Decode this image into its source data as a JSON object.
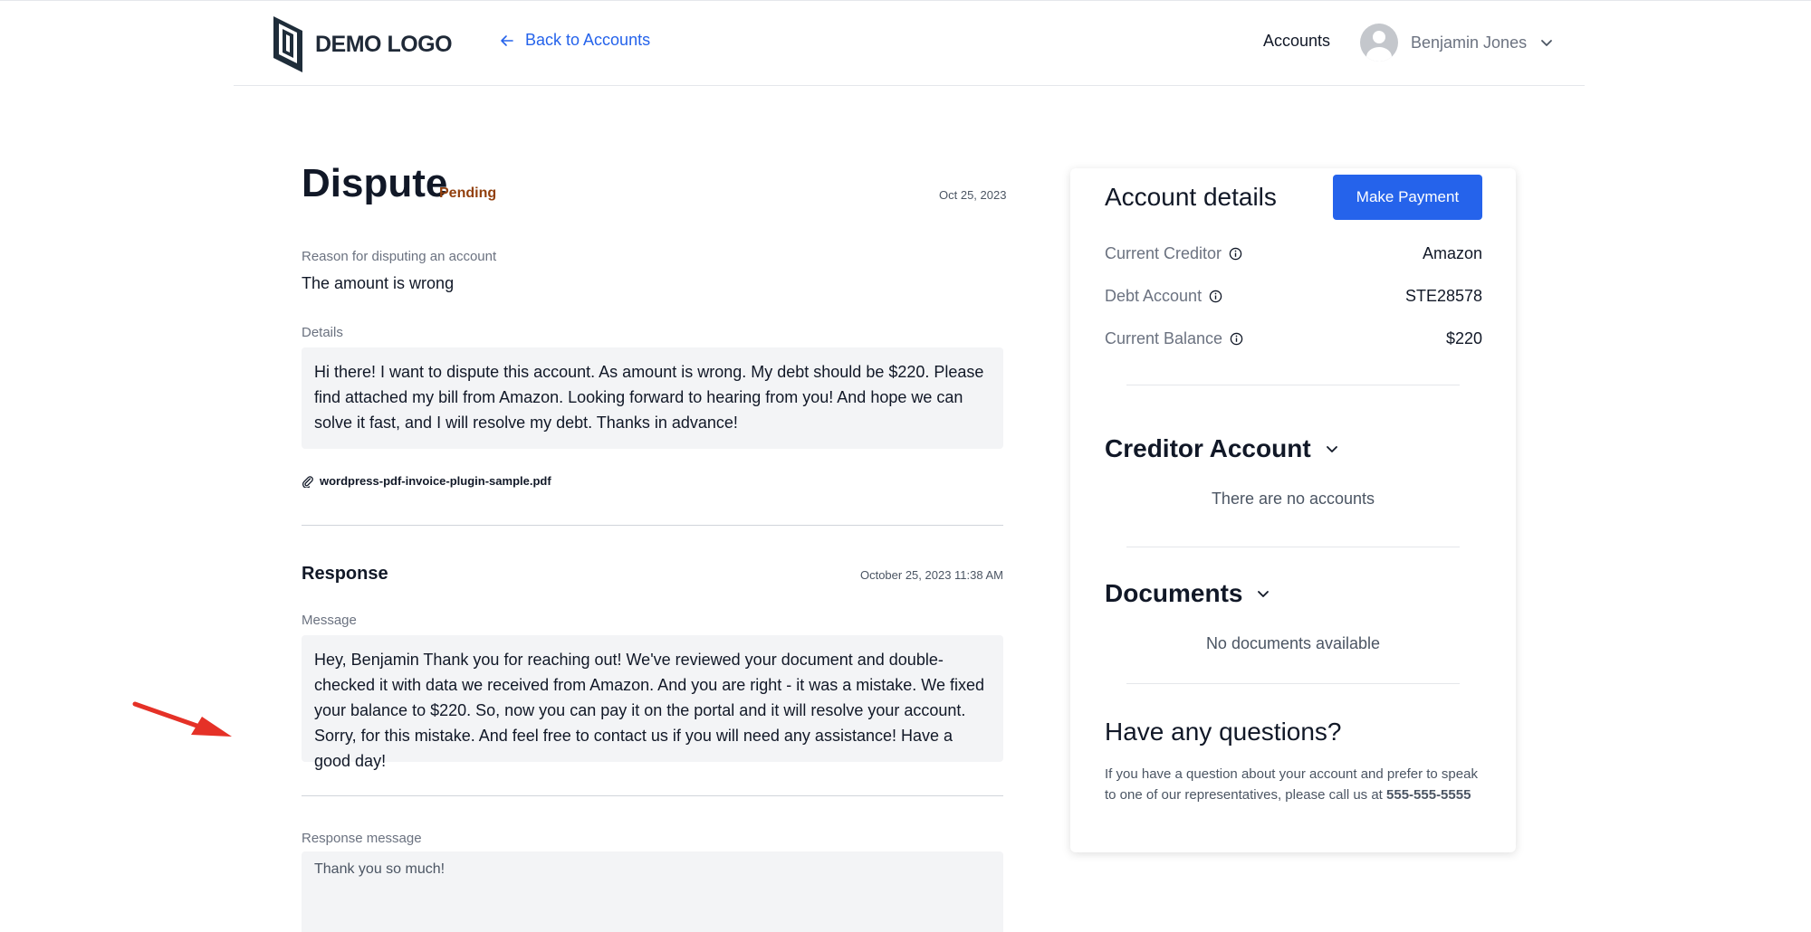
{
  "header": {
    "logo_text": "DEMO LOGO",
    "back_link": "Back to Accounts",
    "nav_accounts": "Accounts",
    "user_name": "Benjamin Jones"
  },
  "dispute": {
    "title": "Dispute",
    "status": "Pending",
    "date": "Oct 25, 2023",
    "reason_label": "Reason for disputing an account",
    "reason_value": "The amount is wrong",
    "details_label": "Details",
    "details_text": "Hi there! I want to dispute this account. As amount is wrong. My debt should be $220. Please find attached my bill from Amazon. Looking forward to hearing from you! And hope we can solve it fast, and I will resolve my debt. Thanks in advance!",
    "attachment": "wordpress-pdf-invoice-plugin-sample.pdf"
  },
  "response": {
    "title": "Response",
    "date": "October 25, 2023 11:38 AM",
    "message_label": "Message",
    "message_text": "Hey, Benjamin Thank you for reaching out! We've reviewed your document and double-checked it with data we received from Amazon. And you are right - it was a mistake. We fixed your balance to $220. So, now you can pay it on the portal and it will resolve your account. Sorry, for this mistake. And feel free to contact us if you will need any assistance! Have a good day!",
    "reply_label": "Response message",
    "reply_placeholder": "Thank you so much!"
  },
  "account_details": {
    "title": "Account details",
    "pay_button": "Make Payment",
    "rows": [
      {
        "label": "Current Creditor",
        "value": "Amazon"
      },
      {
        "label": "Debt Account",
        "value": "STE28578"
      },
      {
        "label": "Current Balance",
        "value": "$220"
      }
    ]
  },
  "creditor_account": {
    "title": "Creditor Account",
    "empty": "There are no accounts"
  },
  "documents": {
    "title": "Documents",
    "empty": "No documents available"
  },
  "questions": {
    "title": "Have any questions?",
    "text": "If you have a question about your account and prefer to speak to one of our representatives, please call us at ",
    "phone": "555-555-5555"
  },
  "colors": {
    "accent": "#2563eb",
    "pending": "#92400e",
    "annotation_arrow": "#e53127"
  }
}
